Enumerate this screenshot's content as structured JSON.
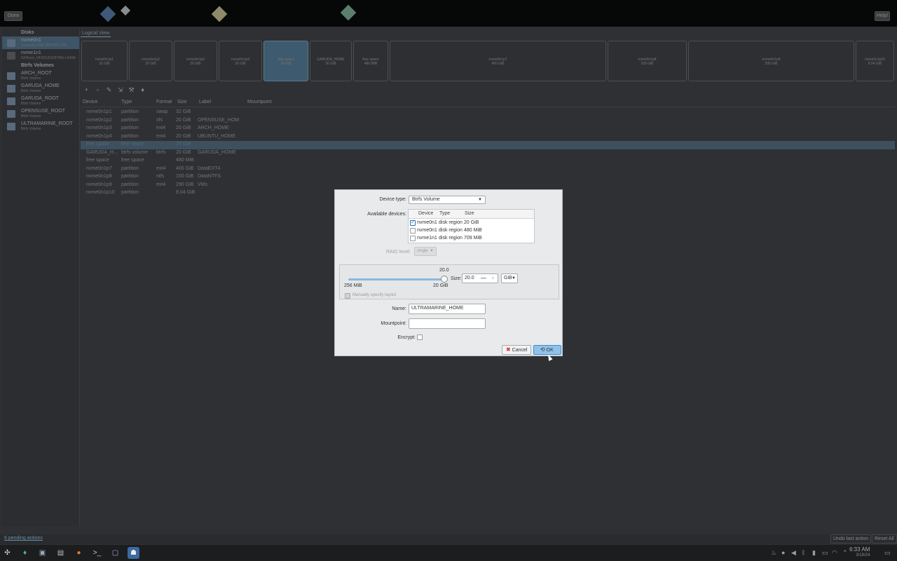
{
  "top": {
    "done_label": "Done",
    "help_label": "Help!"
  },
  "sidebar": {
    "disks_header": "Disks",
    "disks": [
      {
        "name": "nvme0n1",
        "sub": "Samsung SSD 980 PRO 1TB"
      },
      {
        "name": "nvme1n1",
        "sub": "SKHynix_HFS512GD9TNG-L2A0A"
      }
    ],
    "volumes_header": "Btrfs Volumes",
    "volumes": [
      {
        "name": "ARCH_ROOT",
        "sub": "Btrfs Volume"
      },
      {
        "name": "GARUDA_HOME",
        "sub": "Btrfs Volume"
      },
      {
        "name": "GARUDA_ROOT",
        "sub": "Btrfs Volume"
      },
      {
        "name": "OPENSUSE_ROOT",
        "sub": "Btrfs Volume"
      },
      {
        "name": "ULTRAMARINE_ROOT",
        "sub": "Btrfs Volume"
      }
    ]
  },
  "logical_view": {
    "label": "Logical View",
    "parts": [
      {
        "name": "nvme0n1p1",
        "size": "32 GiB"
      },
      {
        "name": "nvme0n1p2",
        "size": "20 GiB"
      },
      {
        "name": "nvme0n1p3",
        "size": "20 GiB"
      },
      {
        "name": "nvme0n1p4",
        "size": "20 GiB"
      },
      {
        "name": "free space",
        "size": "20 GiB"
      },
      {
        "name": "GARUDA_HOME",
        "size": "20 GiB"
      },
      {
        "name": "free space",
        "size": "480 MiB"
      },
      {
        "name": "nvme0n1p7",
        "size": "400 GiB"
      },
      {
        "name": "nvme0n1p8",
        "size": "100 GiB"
      },
      {
        "name": "nvme0n1p9",
        "size": "290 GiB"
      },
      {
        "name": "nvme0n1p10",
        "size": "8.04 GiB"
      }
    ]
  },
  "table": {
    "headers": [
      "Device",
      "Type",
      "Format",
      "Size",
      "Label",
      "Mountpoint"
    ],
    "rows": [
      [
        "nvme0n1p1",
        "partition",
        "swap",
        "32 GiB",
        "",
        ""
      ],
      [
        "nvme0n1p2",
        "partition",
        "xfs",
        "20 GiB",
        "OPENSUSE_HOM",
        ""
      ],
      [
        "nvme0n1p3",
        "partition",
        "ext4",
        "20 GiB",
        "ARCH_HOME",
        ""
      ],
      [
        "nvme0n1p4",
        "partition",
        "ext4",
        "20 GiB",
        "UBUNTU_HOME",
        ""
      ],
      [
        "free space",
        "free space",
        "",
        "20 GiB",
        "",
        ""
      ],
      [
        "GARUDA_H...",
        "btrfs volume",
        "btrfs",
        "20 GiB",
        "GARUDA_HOME",
        ""
      ],
      [
        "free space",
        "free space",
        "",
        "480 MiB",
        "",
        ""
      ],
      [
        "nvme0n1p7",
        "partition",
        "ext4",
        "400 GiB",
        "DataEXT4",
        ""
      ],
      [
        "nvme0n1p8",
        "partition",
        "ntfs",
        "100 GiB",
        "DataNTFS",
        ""
      ],
      [
        "nvme0n1p9",
        "partition",
        "ext4",
        "290 GiB",
        "VMs",
        ""
      ],
      [
        "nvme0n1p10",
        "partition",
        "",
        "8.04 GiB",
        "",
        ""
      ]
    ]
  },
  "dialog": {
    "device_type_label": "Device type:",
    "device_type_value": "Btrfs Volume",
    "available_label": "Available devices:",
    "dev_headers": [
      "Device",
      "Type",
      "Size"
    ],
    "devices": [
      {
        "dev": "nvme0n1",
        "type": "disk region",
        "size": "20 GiB",
        "checked": true
      },
      {
        "dev": "nvme0n1",
        "type": "disk region",
        "size": "480 MiB",
        "checked": false
      },
      {
        "dev": "nvme1n1",
        "type": "disk region",
        "size": "709 MiB",
        "checked": false
      }
    ],
    "raid_label": "RAID level:",
    "raid_value": "single",
    "slider_value": "20.0",
    "slider_min": "256 MiB",
    "slider_max": "20 GiB",
    "slider_fraction": 1.0,
    "size_label": "Size:",
    "size_value": "20.0",
    "size_unit": "GiB",
    "manual_layout_label": "Manually specify layout",
    "name_label": "Name:",
    "name_value": "ULTRAMARINE_HOME",
    "mountpoint_label": "Mountpoint:",
    "mountpoint_value": "",
    "encrypt_label": "Encrypt:",
    "cancel_label": "Cancel",
    "ok_label": "OK"
  },
  "status": {
    "pending": "6 pending actions",
    "undo": "Undo last action",
    "reset": "Reset All"
  },
  "clock": {
    "time": "6:33 AM",
    "date": "3/19/24"
  }
}
